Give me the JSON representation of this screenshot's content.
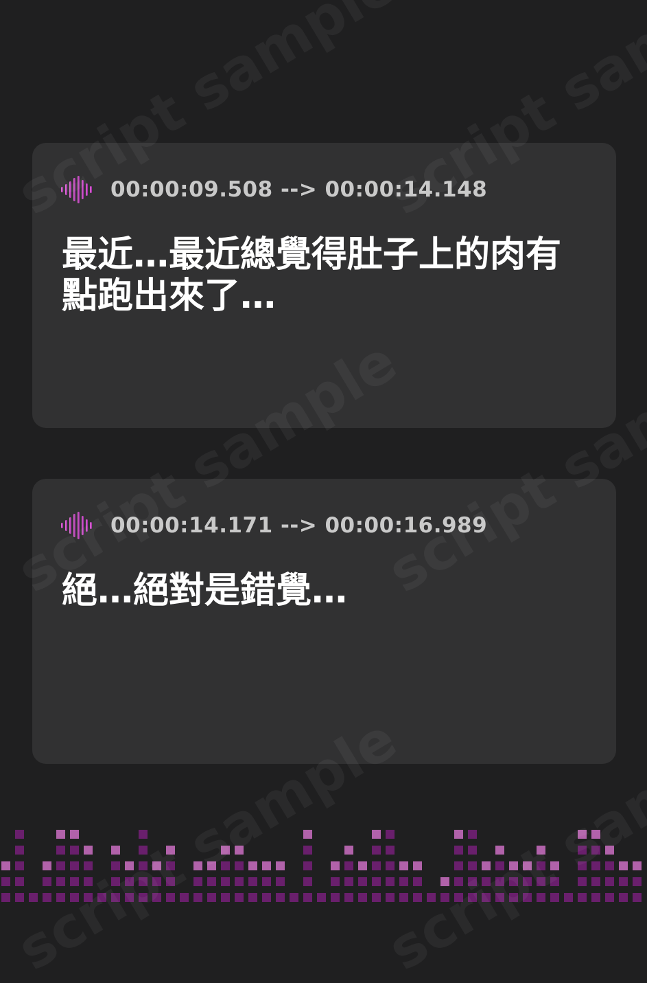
{
  "watermark": {
    "text": "script sample"
  },
  "cues": [
    {
      "icon": "audio-waveform-icon",
      "timestamp": "00:00:09.508 --> 00:00:14.148",
      "text": "最近…最近總覺得肚子上的肉有點跑出來了…"
    },
    {
      "icon": "audio-waveform-icon",
      "timestamp": "00:00:14.171 --> 00:00:16.989",
      "text": "絕…絕對是錯覺…"
    }
  ],
  "colors": {
    "background": "#1f1f20",
    "card": "#313132",
    "accent_light": "#e37ad8",
    "accent_dark": "#9b1fa0",
    "timestamp": "#c9c9c9",
    "subtitle_text": "#ffffff"
  },
  "equalizer_levels": [
    2,
    5,
    0,
    2,
    4,
    4,
    3,
    0,
    3,
    2,
    5,
    2,
    3,
    0,
    2,
    2,
    3,
    3,
    2,
    2,
    2,
    0,
    4,
    0,
    2,
    3,
    2,
    4,
    5,
    2,
    2,
    0,
    1,
    4,
    5,
    2,
    3,
    2,
    2,
    3,
    2,
    0,
    4,
    4,
    3,
    2,
    2
  ]
}
